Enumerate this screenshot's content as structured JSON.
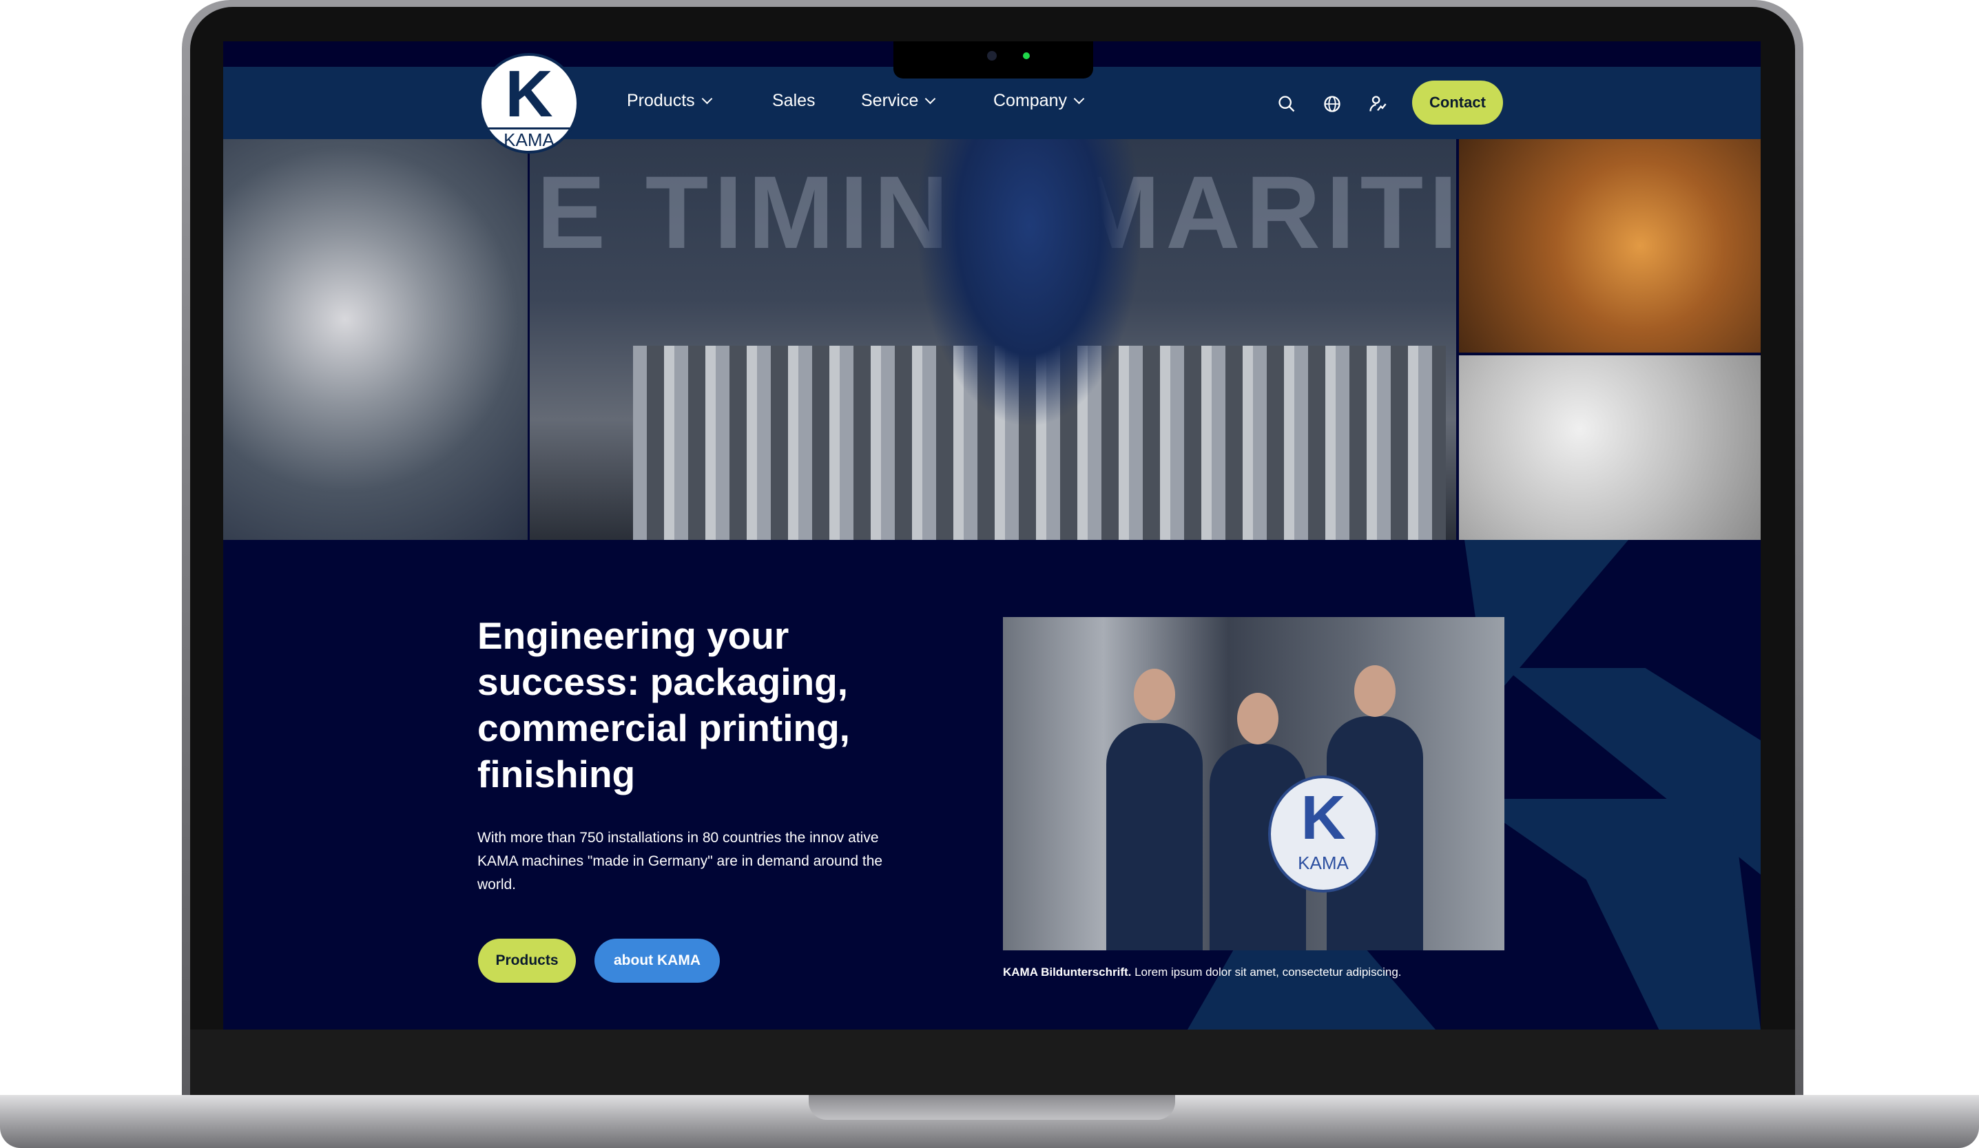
{
  "nav": {
    "logo": {
      "letter": "K",
      "word": "KAMA"
    },
    "items": [
      {
        "label": "Products",
        "has_dropdown": true
      },
      {
        "label": "Sales",
        "has_dropdown": false
      },
      {
        "label": "Service",
        "has_dropdown": true
      },
      {
        "label": "Company",
        "has_dropdown": true
      }
    ],
    "icons": [
      "search-icon",
      "globe-icon",
      "user-login-icon"
    ],
    "contact_label": "Contact"
  },
  "hero": {
    "banner_text": "E TIMING MARITIM FED-TO-WORK"
  },
  "intro": {
    "headline": "Engineering your success: packaging, commercial printing, finishing",
    "paragraph": "With more than 750 installations in 80 countries the innov ative KAMA machines \"made in Germany\" are in demand around the world.",
    "buttons": [
      {
        "label": "Products"
      },
      {
        "label": "about KAMA"
      }
    ],
    "caption_bold": "KAMA Bildunterschrift.",
    "caption_text": " Lorem ipsum dolor sit amet, consectetur adipiscing.",
    "sign": {
      "letter": "K",
      "word": "KAMA"
    }
  },
  "colors": {
    "nav_bg": "#0c2a55",
    "page_bg": "#000535",
    "accent_lime": "#c9dc55",
    "accent_blue": "#3a87dc"
  }
}
